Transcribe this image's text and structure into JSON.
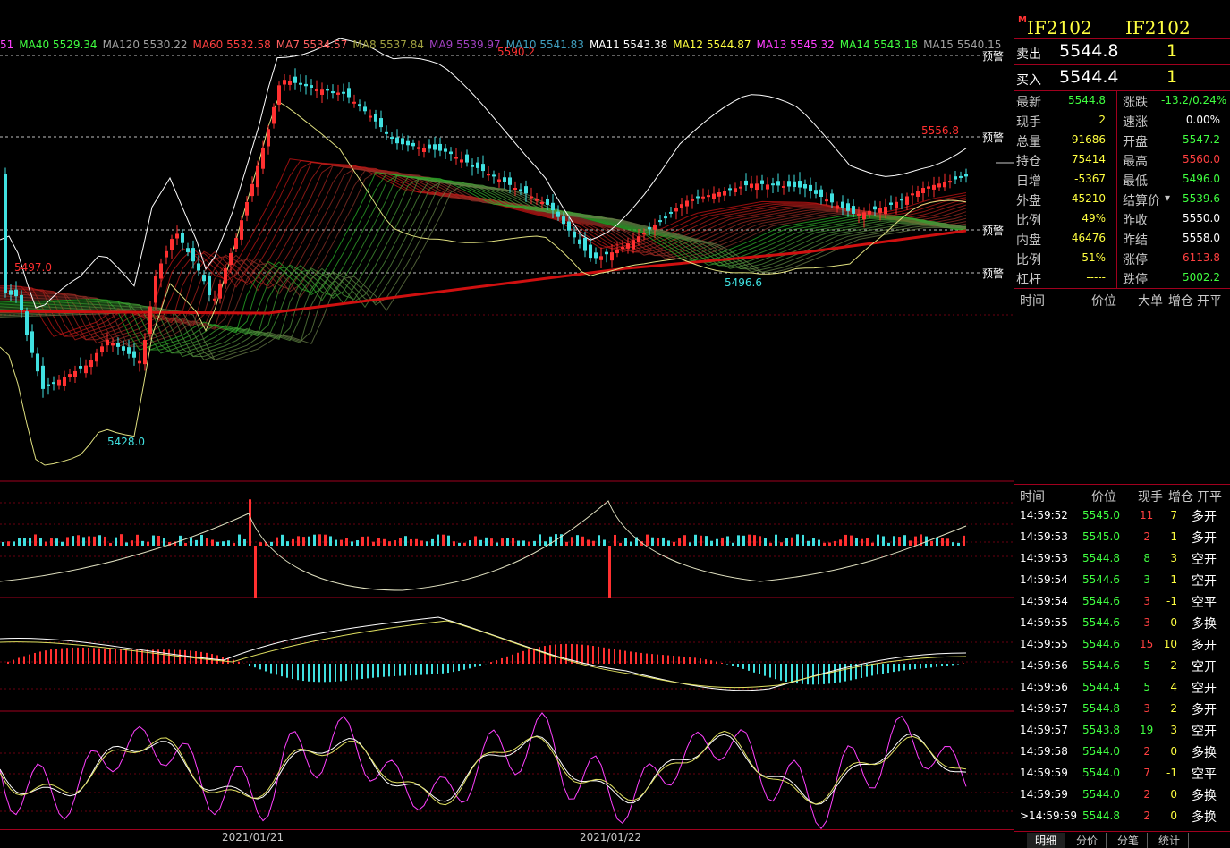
{
  "ma_legend": [
    {
      "label": "51",
      "color": "#ff40ff"
    },
    {
      "label": "MA40 5529.34",
      "color": "#40ff40"
    },
    {
      "label": "MA120 5530.22",
      "color": "#a0a0a0"
    },
    {
      "label": "MA60 5532.58",
      "color": "#ff4040"
    },
    {
      "label": "MA7 5534.57",
      "color": "#ff6060"
    },
    {
      "label": "MA8 5537.84",
      "color": "#a0a040"
    },
    {
      "label": "MA9 5539.97",
      "color": "#a040c0"
    },
    {
      "label": "MA10 5541.83",
      "color": "#40a0c0"
    },
    {
      "label": "MA11 5543.38",
      "color": "#ffffff"
    },
    {
      "label": "MA12 5544.87",
      "color": "#ffff40"
    },
    {
      "label": "MA13 5545.32",
      "color": "#ff40ff"
    },
    {
      "label": "MA14 5543.18",
      "color": "#40ff40"
    },
    {
      "label": "MA15 5540.15",
      "color": "#a0a0a0"
    }
  ],
  "chart_labels": {
    "high_main": "5590.2",
    "high_right": "5556.8",
    "low_left": "5428.0",
    "low_right": "5496.6",
    "left_level": "5497.0",
    "alert": "预警"
  },
  "chart_data": {
    "type": "line",
    "title": "",
    "x": [
      "2021/01/21",
      "2021/01/22"
    ],
    "series": [],
    "annotations": [
      "5590.2",
      "5556.8",
      "5428.0",
      "5496.6",
      "5497.0"
    ]
  },
  "date_axis": [
    "2021/01/21",
    "2021/01/22"
  ],
  "contract": {
    "code_left": "IF2102",
    "code_right": "IF2102",
    "marker": "M"
  },
  "ask": {
    "label": "卖出",
    "price": "5544.8",
    "qty": "1"
  },
  "bid": {
    "label": "买入",
    "price": "5544.4",
    "qty": "1"
  },
  "quote": [
    {
      "l": "最新",
      "lv": "5544.8",
      "lc": "#40ff40",
      "r": "涨跌",
      "rv": "-13.2/0.24%",
      "rc": "#40ff40"
    },
    {
      "l": "现手",
      "lv": "2",
      "lc": "#ffff40",
      "r": "速涨",
      "rv": "0.00%",
      "rc": "#ffffff"
    },
    {
      "l": "总量",
      "lv": "91686",
      "lc": "#ffff40",
      "r": "开盘",
      "rv": "5547.2",
      "rc": "#40ff40"
    },
    {
      "l": "持仓",
      "lv": "75414",
      "lc": "#ffff40",
      "r": "最高",
      "rv": "5560.0",
      "rc": "#ff4040"
    },
    {
      "l": "日增",
      "lv": "-5367",
      "lc": "#ffff40",
      "r": "最低",
      "rv": "5496.0",
      "rc": "#40ff40"
    },
    {
      "l": "外盘",
      "lv": "45210",
      "lc": "#ffff40",
      "r": "结算价",
      "rv": "5539.6",
      "rc": "#40ff40"
    },
    {
      "l": "比例",
      "lv": "49%",
      "lc": "#ffff40",
      "r": "昨收",
      "rv": "5550.0",
      "rc": "#ffffff"
    },
    {
      "l": "内盘",
      "lv": "46476",
      "lc": "#ffff40",
      "r": "昨结",
      "rv": "5558.0",
      "rc": "#ffffff"
    },
    {
      "l": "比例",
      "lv": "51%",
      "lc": "#ffff40",
      "r": "涨停",
      "rv": "6113.8",
      "rc": "#ff4040"
    },
    {
      "l": "杠杆",
      "lv": "-----",
      "lc": "#ffff40",
      "r": "跌停",
      "rv": "5002.2",
      "rc": "#40ff40"
    }
  ],
  "big_header": [
    "时间",
    "价位",
    "大单",
    "增仓",
    "开平"
  ],
  "tick_header": [
    "时间",
    "价位",
    "现手",
    "增仓",
    "开平"
  ],
  "ticks": [
    {
      "t": "14:59:52",
      "p": "5545.0",
      "h": "11",
      "hc": "#ff4040",
      "z": "7",
      "k": "多开"
    },
    {
      "t": "14:59:53",
      "p": "5545.0",
      "h": "2",
      "hc": "#ff4040",
      "z": "1",
      "k": "多开"
    },
    {
      "t": "14:59:53",
      "p": "5544.8",
      "h": "8",
      "hc": "#40ff40",
      "z": "3",
      "k": "空开"
    },
    {
      "t": "14:59:54",
      "p": "5544.6",
      "h": "3",
      "hc": "#40ff40",
      "z": "1",
      "k": "空开"
    },
    {
      "t": "14:59:54",
      "p": "5544.6",
      "h": "3",
      "hc": "#ff4040",
      "z": "-1",
      "k": "空平"
    },
    {
      "t": "14:59:55",
      "p": "5544.6",
      "h": "3",
      "hc": "#ff4040",
      "z": "0",
      "k": "多换"
    },
    {
      "t": "14:59:55",
      "p": "5544.6",
      "h": "15",
      "hc": "#ff4040",
      "z": "10",
      "k": "多开"
    },
    {
      "t": "14:59:56",
      "p": "5544.6",
      "h": "5",
      "hc": "#40ff40",
      "z": "2",
      "k": "空开"
    },
    {
      "t": "14:59:56",
      "p": "5544.4",
      "h": "5",
      "hc": "#40ff40",
      "z": "4",
      "k": "空开"
    },
    {
      "t": "14:59:57",
      "p": "5544.8",
      "h": "3",
      "hc": "#ff4040",
      "z": "2",
      "k": "多开"
    },
    {
      "t": "14:59:57",
      "p": "5543.8",
      "h": "19",
      "hc": "#40ff40",
      "z": "3",
      "k": "空开"
    },
    {
      "t": "14:59:58",
      "p": "5544.0",
      "h": "2",
      "hc": "#ff4040",
      "z": "0",
      "k": "多换"
    },
    {
      "t": "14:59:59",
      "p": "5544.0",
      "h": "7",
      "hc": "#ff4040",
      "z": "-1",
      "k": "空平"
    },
    {
      "t": "14:59:59",
      "p": "5544.0",
      "h": "2",
      "hc": "#ff4040",
      "z": "0",
      "k": "多换"
    },
    {
      "t": ">14:59:59",
      "p": "5544.8",
      "h": "2",
      "hc": "#ff4040",
      "z": "0",
      "k": "多换"
    }
  ],
  "tabs": [
    "明细",
    "分价",
    "分笔",
    "统计"
  ],
  "colors": {
    "up": "#ff3030",
    "down": "#40e0e0",
    "frame": "#a0001e"
  }
}
